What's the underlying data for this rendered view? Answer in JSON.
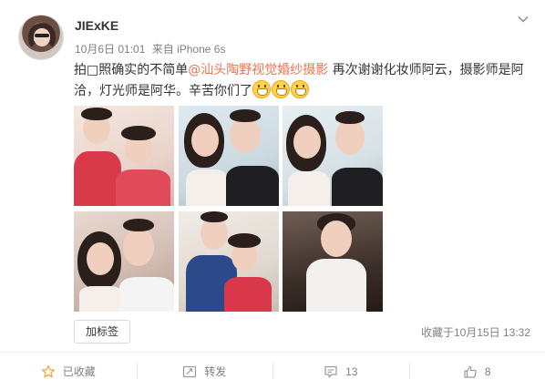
{
  "post": {
    "username": "JIExKE",
    "date": "10月6日 01:01",
    "source": "来自 iPhone 6s",
    "text_before_link": "拍□照确实的不简单",
    "link": "@汕头陶野视觉婚纱摄影",
    "text_after_link": " 再次谢谢化妆师阿云，摄影师是阿洽，灯光师是阿华。辛苦你们了",
    "emoji_name": "grin-emoji",
    "emoji_count": 3
  },
  "footer": {
    "tag_button": "加标签",
    "favorited_time": "收藏于10月15日 13:32"
  },
  "actions": [
    {
      "label": "已收藏",
      "icon": "star-icon"
    },
    {
      "label": "转发",
      "icon": "repost-icon"
    },
    {
      "label": "13",
      "icon": "comment-icon"
    },
    {
      "label": "8",
      "icon": "thumbs-up-icon"
    }
  ],
  "colors": {
    "link": "#eb7350",
    "favorite_star": "#f7a53a",
    "meta_gray": "#808080"
  }
}
